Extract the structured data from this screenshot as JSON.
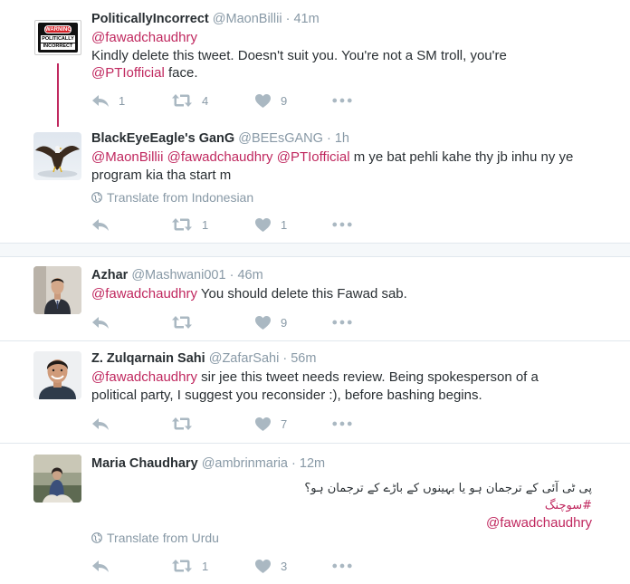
{
  "colors": {
    "mention": "#c0285f",
    "muted": "#8899a6",
    "icon": "#aab8c2"
  },
  "tweets": [
    {
      "name": "PoliticallyIncorrect",
      "handle": "@MaonBillii",
      "time": "41m",
      "avatar": {
        "icon": "warning-sign-avatar",
        "line1": "WARNING",
        "line2": "POLITICALLY",
        "line3": "INCORRECT"
      },
      "mention1": "@fawadchaudhry",
      "text1": "Kindly delete this tweet. Doesn't suit you. You're not a SM troll, you're",
      "mention2": "@PTIofficial",
      "text2": " face.",
      "replies": "1",
      "retweets": "4",
      "likes": "9"
    },
    {
      "name": "BlackEyeEagle's GanG",
      "handle": "@BEEsGANG",
      "time": "1h",
      "avatar": {
        "icon": "eagle-avatar"
      },
      "mention1": "@MaonBillii",
      "mention2": "@fawadchaudhry",
      "mention3": "@PTIofficial",
      "text": " m ye bat pehli kahe thy jb inhu ny ye program kia tha start m",
      "translate": "Translate from Indonesian",
      "replies": "",
      "retweets": "1",
      "likes": "1"
    },
    {
      "name": "Azhar",
      "handle": "@Mashwani001",
      "time": "46m",
      "avatar": {
        "icon": "man-suit-avatar"
      },
      "mention1": "@fawadchaudhry",
      "text": " You should delete this Fawad sab.",
      "replies": "",
      "retweets": "",
      "likes": "9"
    },
    {
      "name": "Z. Zulqarnain Sahi",
      "handle": "@ZafarSahi",
      "time": "56m",
      "avatar": {
        "icon": "smiling-man-avatar"
      },
      "mention1": "@fawadchaudhry",
      "text": " sir jee this tweet needs review. Being spokesperson of a political party, I suggest you reconsider :), before bashing begins.",
      "replies": "",
      "retweets": "",
      "likes": "7"
    },
    {
      "name": "Maria Chaudhary",
      "handle": "@ambrinmaria",
      "time": "12m",
      "avatar": {
        "icon": "woman-photo-avatar"
      },
      "urdu": "پی ٹی آئی کے ترجمان ہو یا بہینوں کے باڑے کے ترجمان ہو؟",
      "hashtag": "#سوچنگ",
      "mention1": "@fawadchaudhry",
      "translate": "Translate from Urdu",
      "replies": "",
      "retweets": "1",
      "likes": "3"
    }
  ],
  "separators": {
    "dot": "·"
  }
}
